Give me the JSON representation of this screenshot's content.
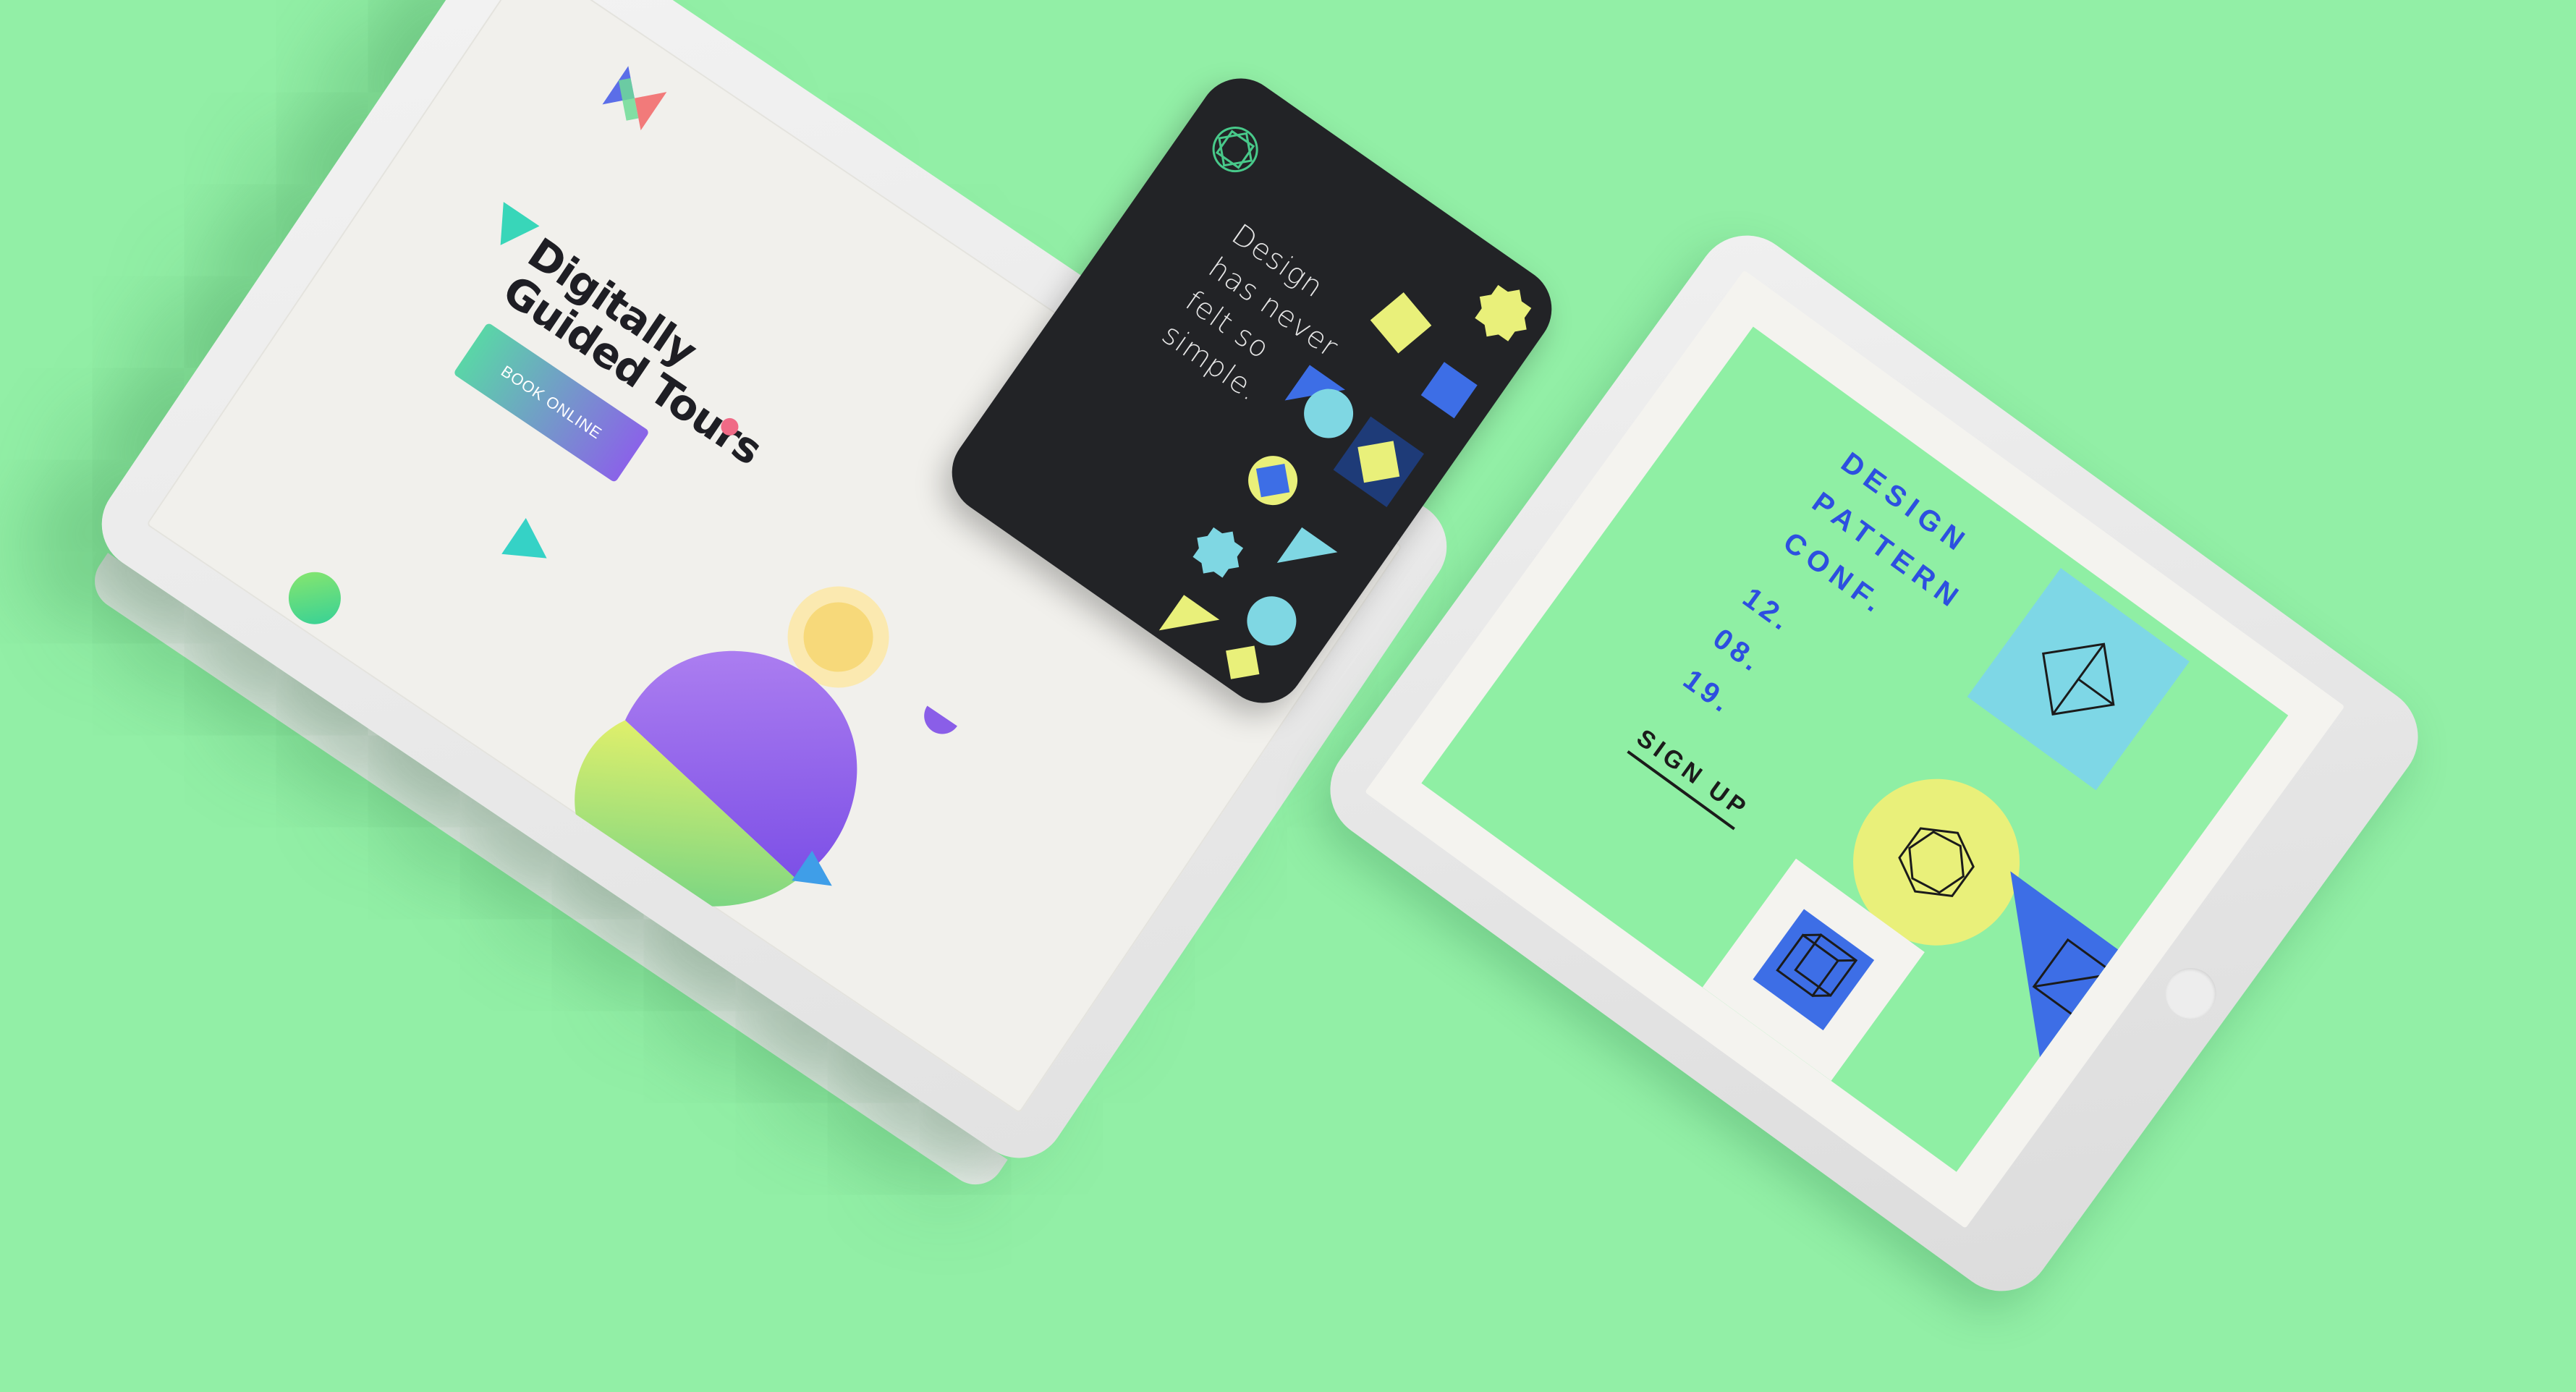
{
  "laptop": {
    "headline_line1": "Digitally",
    "headline_line2": "Guided Tours",
    "book_button": "BOOK ONLINE",
    "logo_icon": "x-logo-icon"
  },
  "phone": {
    "line1": "Design",
    "line2": "has never",
    "line3": "felt so",
    "line4": "simple.",
    "logo_icon": "geometric-emblem-icon"
  },
  "tablet": {
    "title_line1": "DESIGN",
    "title_line2": "PATTERN",
    "title_line3": "CONF.",
    "date_line1": "12.",
    "date_line2": "08.",
    "date_line3": "19.",
    "signup_button": "SIGN UP"
  },
  "colors": {
    "background": "#92efa6",
    "phone_body": "#222326",
    "accent_blue": "#2d4fe0",
    "accent_yellow": "#e9f07a",
    "accent_cyan": "#7ed7e6",
    "accent_purple": "#8a63e8"
  }
}
